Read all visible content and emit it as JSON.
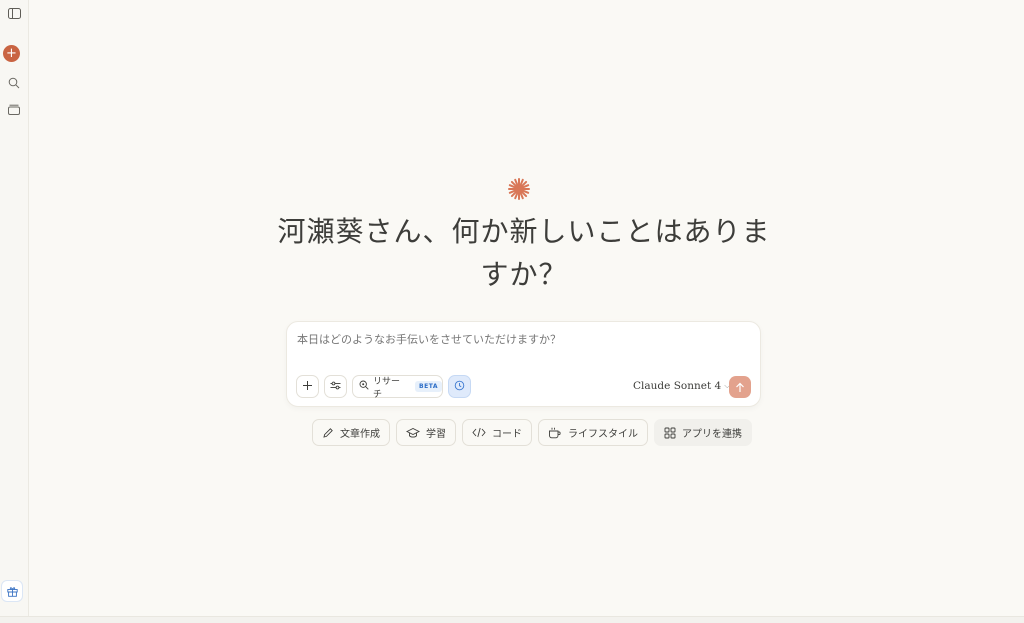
{
  "sidebar": {
    "toggle_icon": "sidebar-toggle-icon",
    "new_chat_symbol": "+",
    "search_icon": "search-icon",
    "projects_icon": "archive-icon",
    "gift_icon": "gift-icon",
    "accent": "#c96442"
  },
  "main": {
    "logo_icon": "claude-spark-icon",
    "greeting_line1": "河瀬葵さん、何か新しいことはありま",
    "greeting_line2": "すか？"
  },
  "composer": {
    "placeholder": "本日はどのようなお手伝いをさせていただけますか？",
    "add_symbol": "+",
    "research_label": "リサーチ",
    "research_badge": "BETA",
    "model_name": "Claude Sonnet 4",
    "model_chevron": "⌵",
    "send_color": "#e3a28d"
  },
  "chips": [
    {
      "label": "文章作成",
      "icon": "pencil-icon"
    },
    {
      "label": "学習",
      "icon": "graduation-cap-icon"
    },
    {
      "label": "コード",
      "icon": "code-icon"
    },
    {
      "label": "ライフスタイル",
      "icon": "coffee-cup-icon"
    },
    {
      "label": "アプリを連携",
      "icon": "apps-grid-icon"
    }
  ]
}
